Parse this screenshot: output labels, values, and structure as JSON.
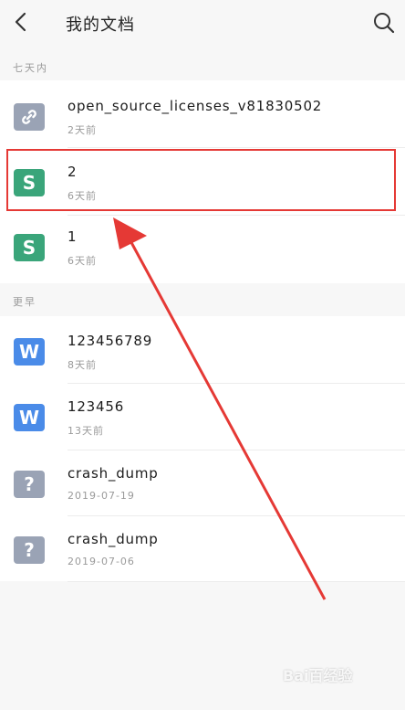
{
  "header": {
    "title": "我的文档"
  },
  "sections": [
    {
      "label": "七天内"
    },
    {
      "label": "更早"
    }
  ],
  "files": [
    {
      "name": "open_source_licenses_v81830502",
      "meta": "2天前",
      "type": "link",
      "color": "#9aa3b5"
    },
    {
      "name": "2",
      "meta": "6天前",
      "type": "sheet",
      "color": "#3aa57a"
    },
    {
      "name": "1",
      "meta": "6天前",
      "type": "sheet",
      "color": "#3aa57a"
    },
    {
      "name": "123456789",
      "meta": "8天前",
      "type": "word",
      "color": "#4a8be8"
    },
    {
      "name": "123456",
      "meta": "13天前",
      "type": "word",
      "color": "#4a8be8"
    },
    {
      "name": "crash_dump",
      "meta": "2019-07-19",
      "type": "unknown",
      "color": "#9aa3b5"
    },
    {
      "name": "crash_dump",
      "meta": "2019-07-06",
      "type": "unknown",
      "color": "#9aa3b5"
    }
  ],
  "icons": {
    "link": "S",
    "sheet": "S",
    "word": "W",
    "unknown": "?"
  },
  "annotation_color": "#e53935",
  "watermark": "Bai百经验"
}
